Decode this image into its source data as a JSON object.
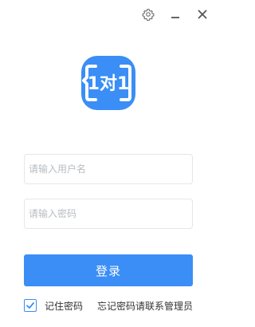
{
  "titlebar": {
    "settings_icon": "gear-icon",
    "minimize_icon": "minimize-icon",
    "close_icon": "close-icon"
  },
  "logo": {
    "text": "1对1",
    "color": "#3a8ef6"
  },
  "form": {
    "username_placeholder": "请输入用户名",
    "username_value": "",
    "password_placeholder": "请输入密码",
    "password_value": ""
  },
  "login_button": {
    "label": "登录",
    "color": "#3a8ef6"
  },
  "remember": {
    "label": "记住密码",
    "checked": true
  },
  "forgot": {
    "label": "忘记密码请联系管理员"
  }
}
